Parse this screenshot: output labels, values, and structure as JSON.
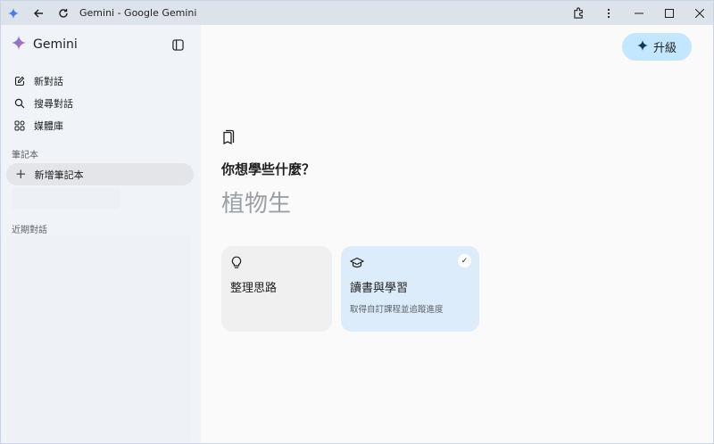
{
  "window": {
    "title": "Gemini - Google Gemini"
  },
  "sidebar": {
    "brand": "Gemini",
    "nav": [
      {
        "icon": "edit-icon",
        "label": "新對話"
      },
      {
        "icon": "search-icon",
        "label": "搜尋對話"
      },
      {
        "icon": "media-library-icon",
        "label": "媒體庫"
      }
    ],
    "notebook_section": "筆記本",
    "new_notebook": "新增筆記本",
    "recent_section": "近期對話"
  },
  "main": {
    "upgrade_label": "升級",
    "question": "你想學些什麼？",
    "topic_placeholder": "植物生",
    "cards": [
      {
        "icon": "lightbulb-icon",
        "title": "整理思路",
        "desc": "",
        "selected": false
      },
      {
        "icon": "graduation-cap-icon",
        "title": "讀書與學習",
        "desc": "取得自訂課程並追蹤進度",
        "selected": true
      }
    ]
  },
  "colors": {
    "accent": "#c2e7ff",
    "selected_card": "#dcecfb",
    "sidebar_bg": "#f0f4f9",
    "titlebar_bg": "#dde3ea"
  }
}
